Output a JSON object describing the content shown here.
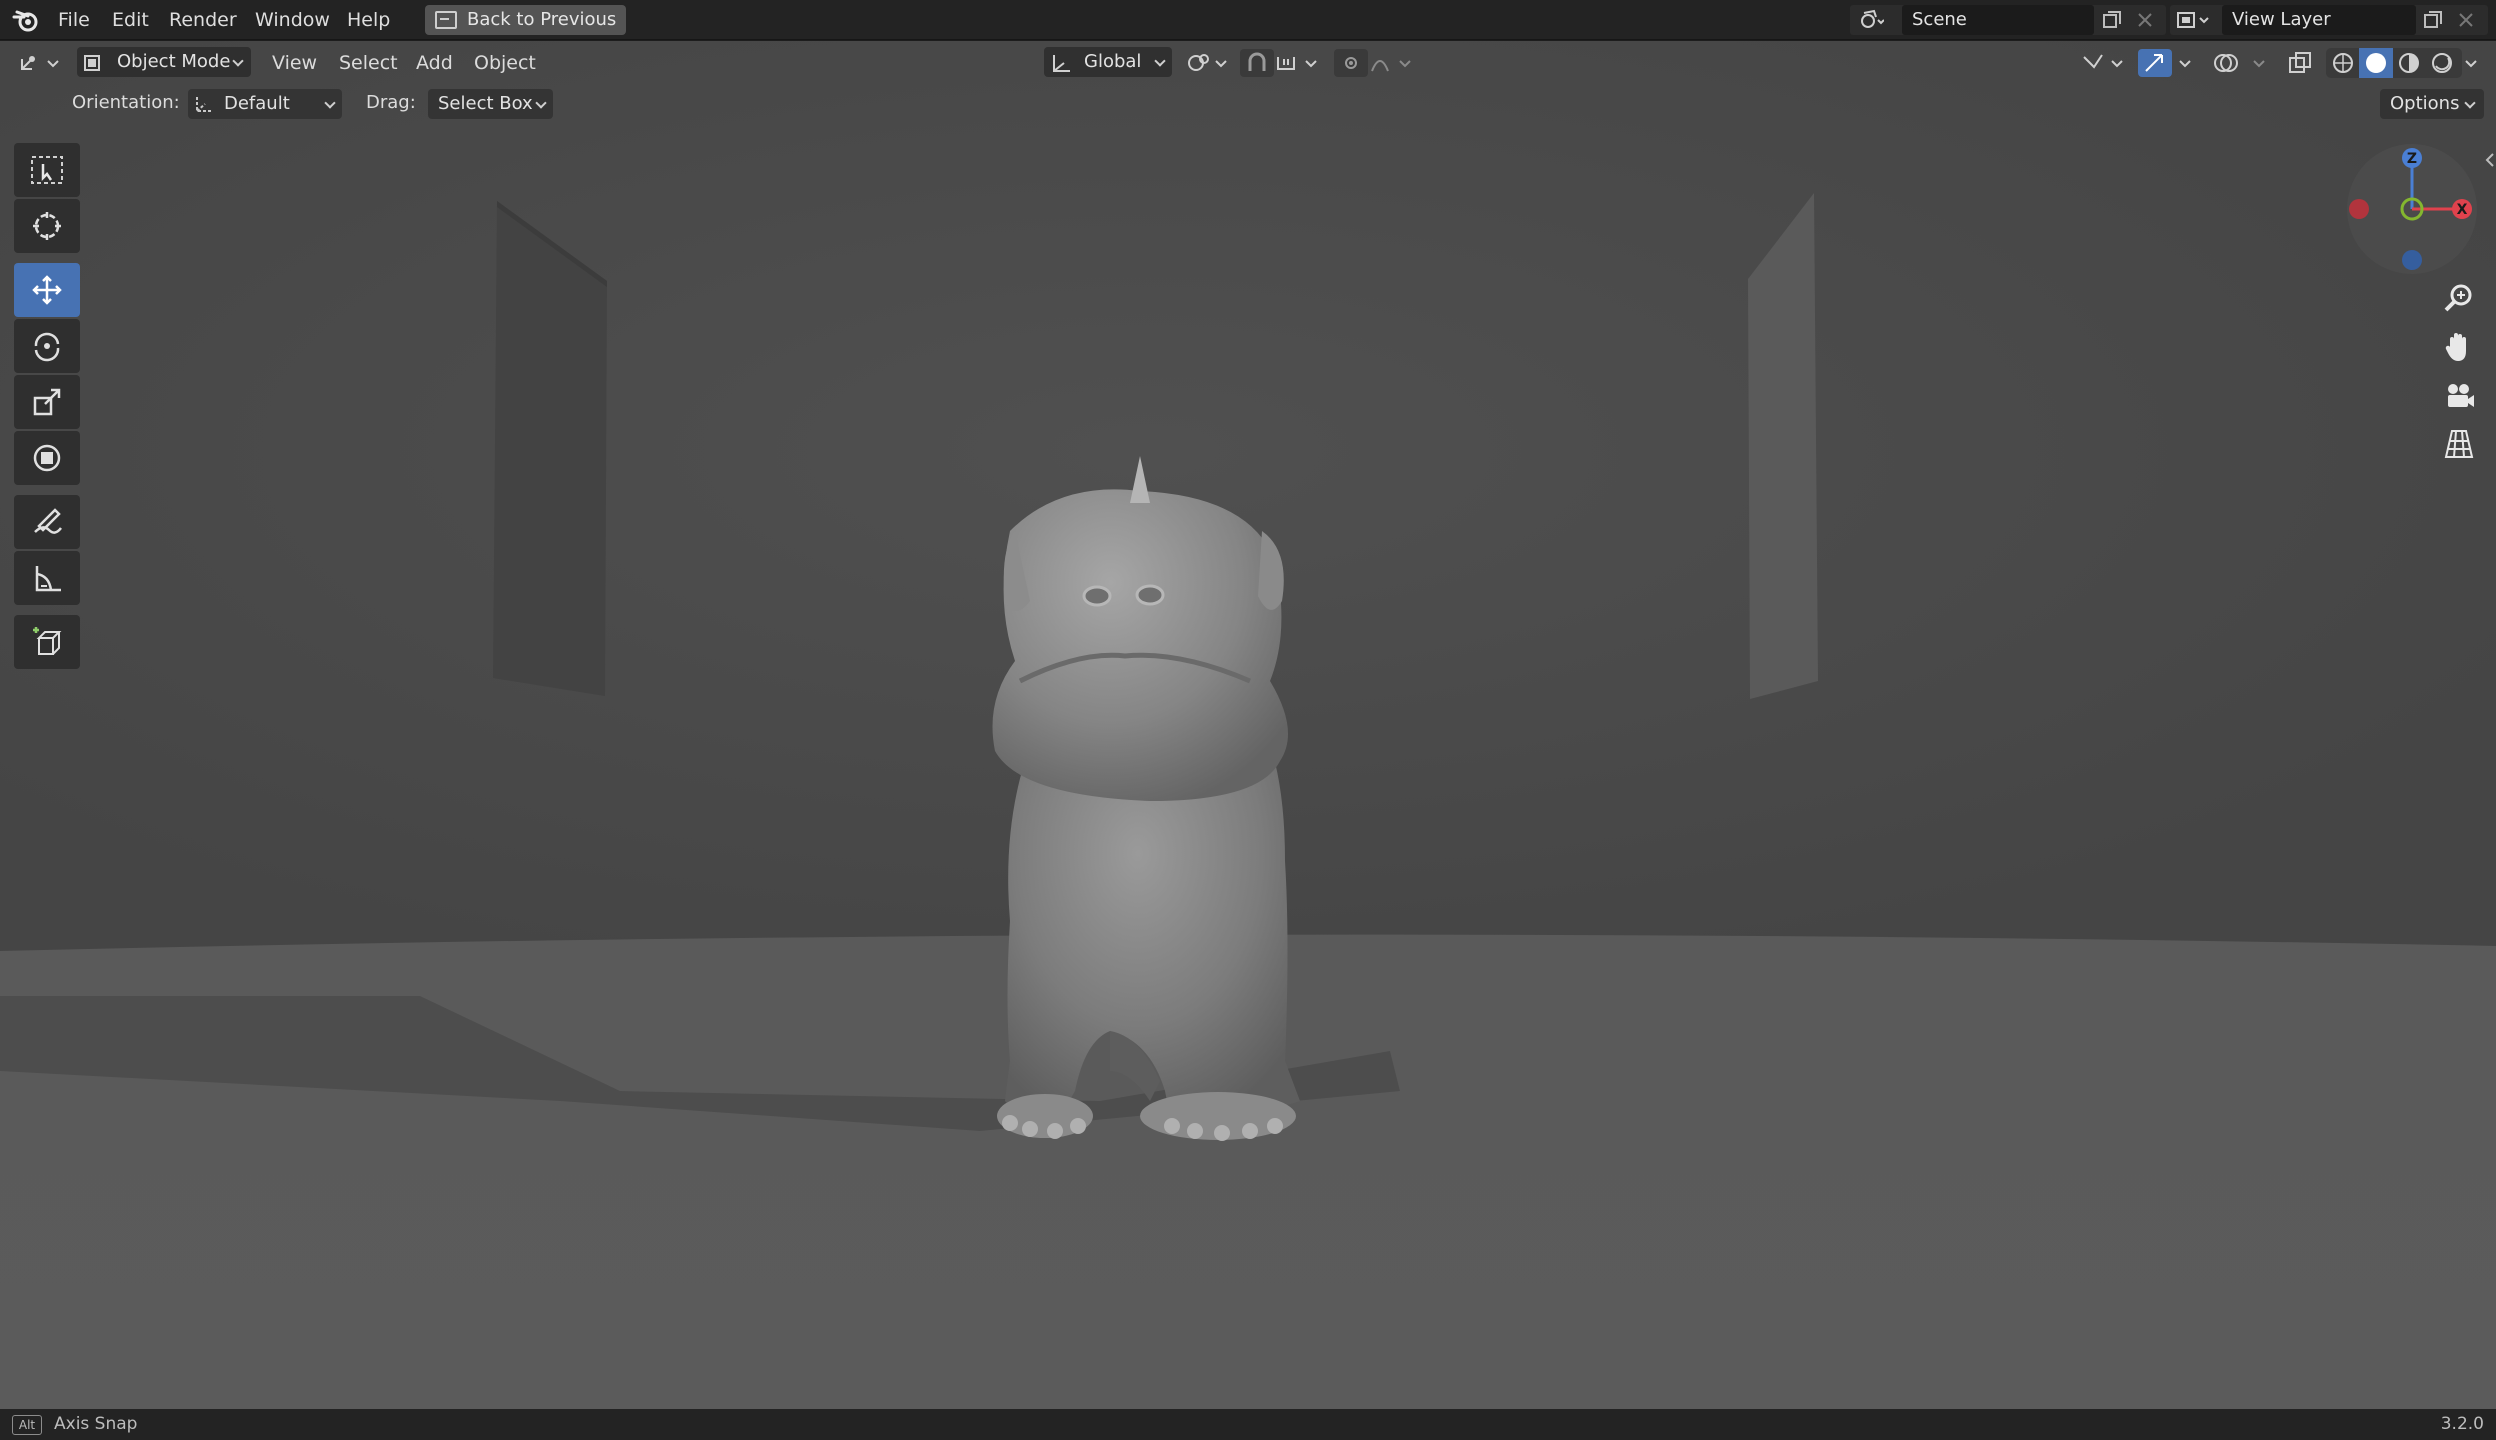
{
  "topbar": {
    "menus": [
      "File",
      "Edit",
      "Render",
      "Window",
      "Help"
    ],
    "back_label": "Back to Previous",
    "scene_value": "Scene",
    "view_layer_value": "View Layer"
  },
  "viewport_header": {
    "mode": "Object Mode",
    "menus": [
      "View",
      "Select",
      "Add",
      "Object"
    ],
    "transform_orientation": "Global"
  },
  "tool_settings": {
    "orientation_label": "Orientation:",
    "orientation_value": "Default",
    "drag_label": "Drag:",
    "drag_value": "Select Box",
    "options_label": "Options"
  },
  "toolbar": {
    "tools": [
      {
        "name": "select-box-tool",
        "active": false
      },
      {
        "name": "cursor-tool",
        "active": false
      },
      {
        "name": "move-tool",
        "active": true
      },
      {
        "name": "rotate-tool",
        "active": false
      },
      {
        "name": "scale-tool",
        "active": false
      },
      {
        "name": "transform-tool",
        "active": false
      },
      {
        "name": "annotate-tool",
        "active": false
      },
      {
        "name": "measure-tool",
        "active": false
      },
      {
        "name": "add-cube-tool",
        "active": false
      }
    ]
  },
  "gizmo": {
    "x_label": "X",
    "z_label": "Z",
    "colors": {
      "x": "#e0424d",
      "y": "#84b72f",
      "z": "#4a7fd4"
    }
  },
  "statusbar": {
    "key": "Alt",
    "hint": "Axis Snap",
    "version": "3.2.0"
  },
  "colors": {
    "accent": "#4772b3",
    "background": "#232323",
    "viewport": "#4a4a4a"
  }
}
